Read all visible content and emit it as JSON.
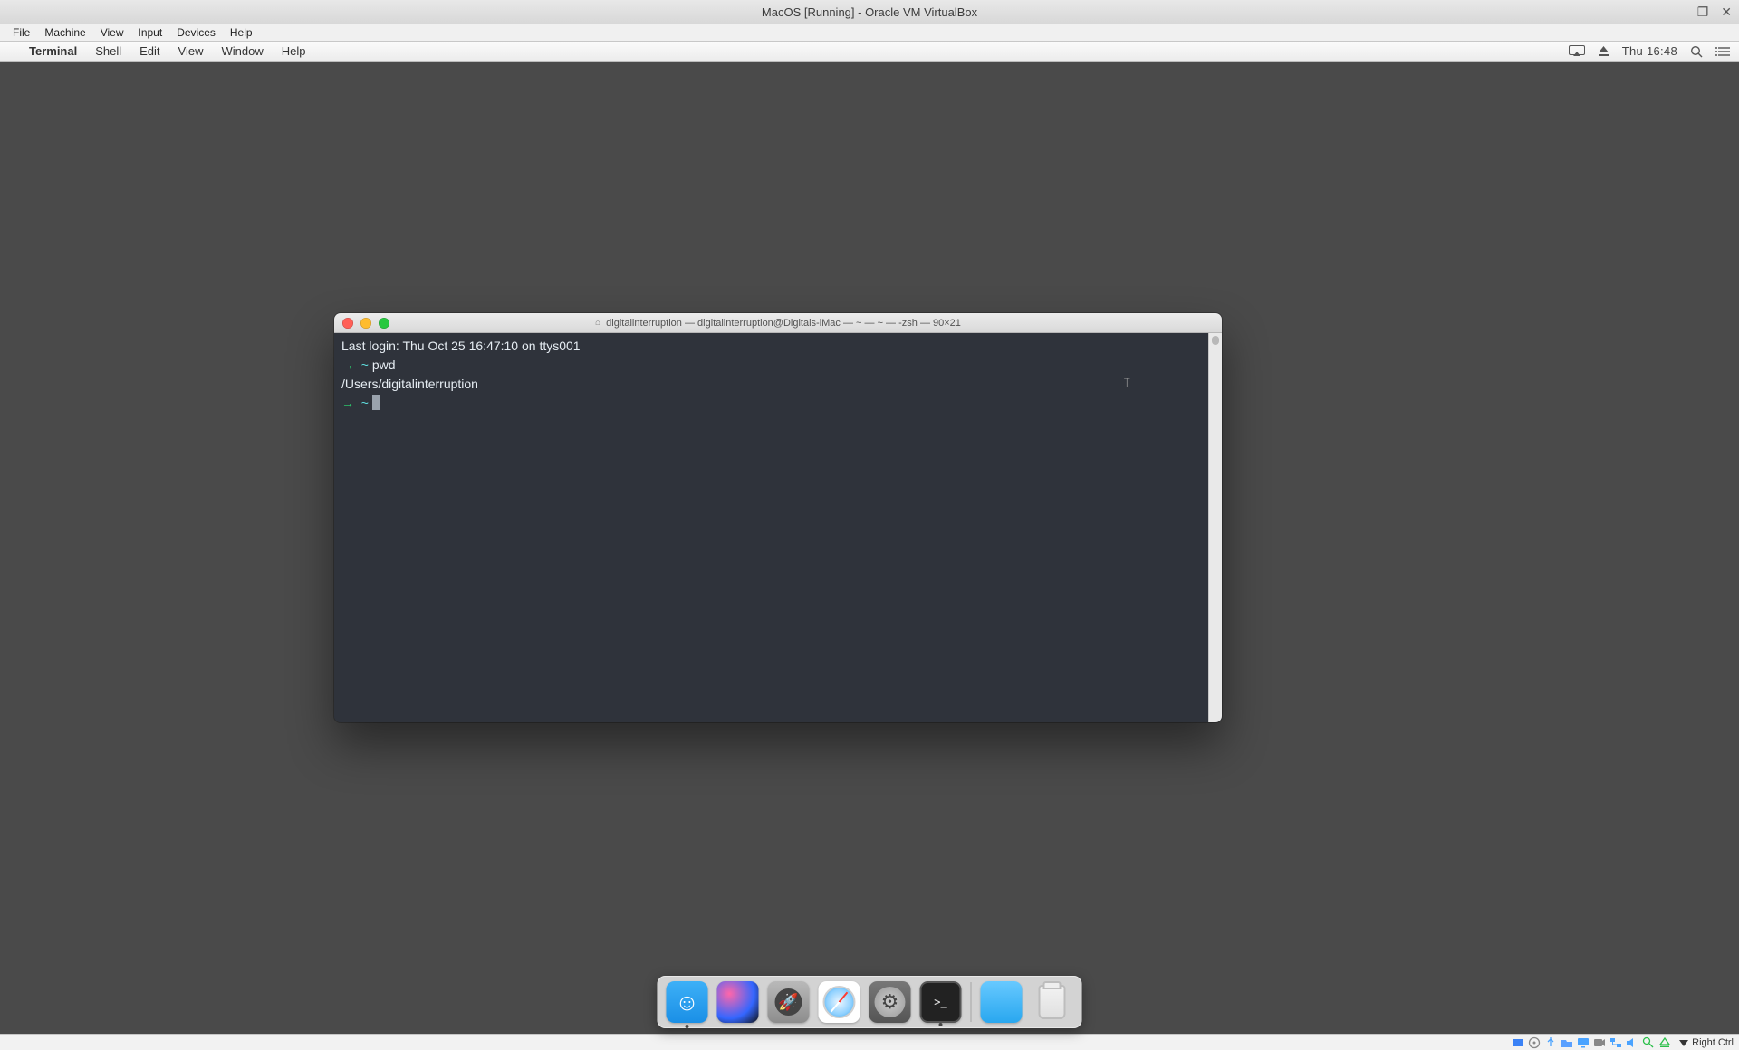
{
  "vbox": {
    "title": "MacOS [Running] - Oracle VM VirtualBox",
    "menu": {
      "file": "File",
      "machine": "Machine",
      "view": "View",
      "input": "Input",
      "devices": "Devices",
      "help": "Help"
    },
    "window_controls": {
      "minimize": "–",
      "maximize": "❐",
      "close": "✕"
    },
    "status_icons": [
      "hd",
      "disc",
      "usb",
      "folder",
      "display1",
      "display2",
      "network",
      "audio",
      "mouse",
      "keyboard"
    ],
    "hostkey": "Right Ctrl"
  },
  "mac_menubar": {
    "app": "Terminal",
    "items": {
      "shell": "Shell",
      "edit": "Edit",
      "view": "View",
      "window": "Window",
      "help": "Help"
    },
    "clock": "Thu 16:48"
  },
  "terminal": {
    "title": "digitalinterruption — digitalinterruption@Digitals-iMac — ~ — ~ — -zsh — 90×21",
    "last_login": "Last login: Thu Oct 25 16:47:10 on ttys001",
    "prompt_arrow": "→",
    "prompt_tilde": "~",
    "cmd1": "pwd",
    "output1": "/Users/digitalinterruption"
  },
  "dock": {
    "items": [
      "finder",
      "siri",
      "launchpad",
      "safari",
      "settings",
      "terminal",
      "downloads",
      "trash"
    ]
  }
}
